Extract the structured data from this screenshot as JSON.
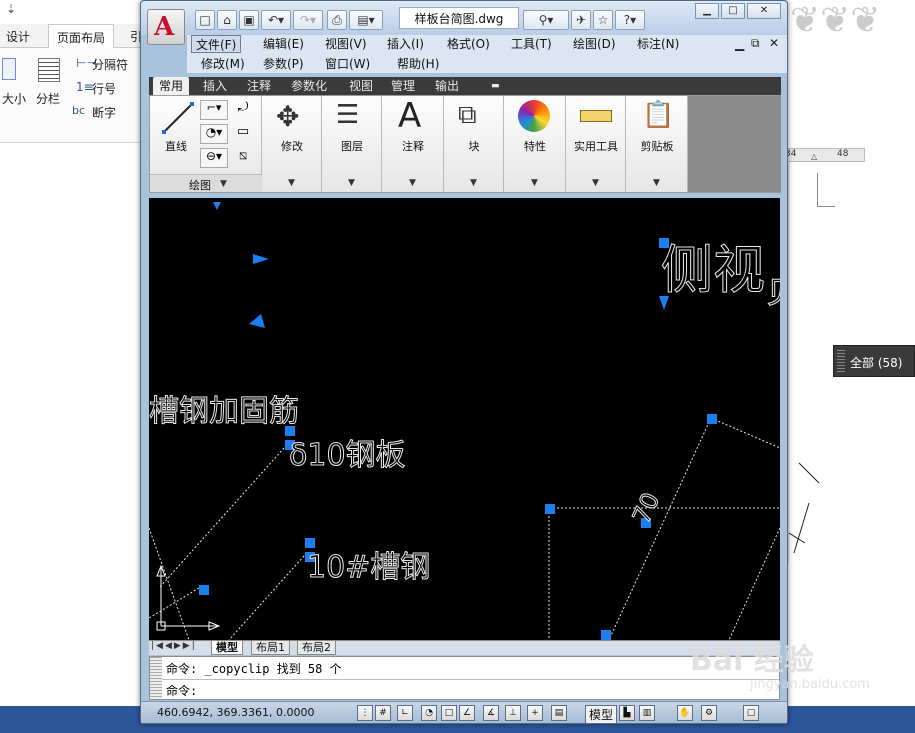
{
  "word": {
    "tabs": [
      "设计",
      "页面布局",
      "引"
    ],
    "ribbon": {
      "size_label": "大小",
      "columns_label": "分栏",
      "breaks_label": "分隔符",
      "line_numbers_label": "行号",
      "hyphenation_label": "断字",
      "hyphen_glyph": "bc"
    },
    "ruler": {
      "left_value": "34",
      "right_value": "48"
    }
  },
  "cad": {
    "logo_letter": "A",
    "doc_title": "样板台简图.dwg",
    "menu_row1": [
      "文件(F)",
      "编辑(E)",
      "视图(V)",
      "插入(I)",
      "格式(O)",
      "工具(T)",
      "绘图(D)",
      "标注(N)"
    ],
    "menu_row2": [
      "修改(M)",
      "参数(P)",
      "窗口(W)",
      "帮助(H)"
    ],
    "ribbon_tabs": [
      "常用",
      "插入",
      "注释",
      "参数化",
      "视图",
      "管理",
      "输出"
    ],
    "panels": {
      "draw_line": "直线",
      "draw_group": "绘图",
      "modify": "修改",
      "layers": "图层",
      "annotation": "注释",
      "block": "块",
      "properties": "特性",
      "utilities": "实用工具",
      "clipboard": "剪贴板"
    },
    "drawing": {
      "texts": {
        "side_view": "侧视",
        "side_view_cut": "见",
        "channel_reinforcement": "槽钢加固筋",
        "steel_plate": "δ10钢板",
        "channel_steel": "10#槽钢",
        "dimension": "70"
      }
    },
    "layout_tabs": [
      "模型",
      "布局1",
      "布局2"
    ],
    "command_lines": [
      "命令: _copyclip 找到 58 个",
      "命令:"
    ],
    "coordinates": "460.6942, 369.3361, 0.0000",
    "model_label": "模型"
  },
  "layer_popup": {
    "label": "全部 (58)"
  },
  "watermark": {
    "brand": "Bai 经验",
    "url": "jingyan.baidu.com"
  }
}
